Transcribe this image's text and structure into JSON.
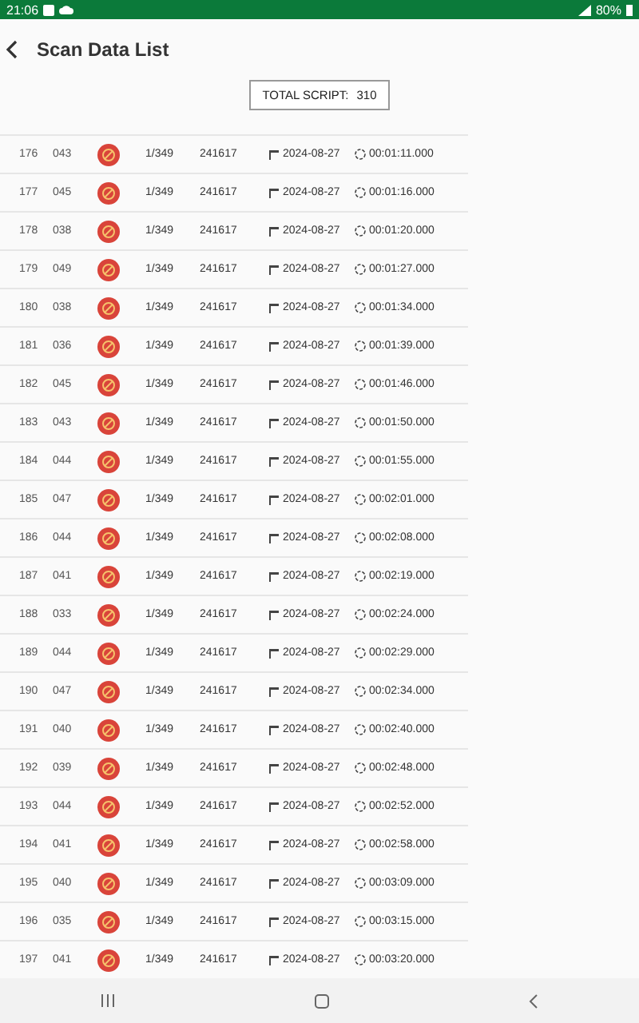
{
  "status_bar": {
    "time": "21:06",
    "battery": "80%"
  },
  "header": {
    "title": "Scan Data List"
  },
  "total": {
    "label": "TOTAL SCRIPT:",
    "value": "310"
  },
  "rows": [
    {
      "no": "176",
      "code": "043",
      "ref": "1/349",
      "batch": "241617",
      "date": "2024-08-27",
      "time": "00:01:11.000"
    },
    {
      "no": "177",
      "code": "045",
      "ref": "1/349",
      "batch": "241617",
      "date": "2024-08-27",
      "time": "00:01:16.000"
    },
    {
      "no": "178",
      "code": "038",
      "ref": "1/349",
      "batch": "241617",
      "date": "2024-08-27",
      "time": "00:01:20.000"
    },
    {
      "no": "179",
      "code": "049",
      "ref": "1/349",
      "batch": "241617",
      "date": "2024-08-27",
      "time": "00:01:27.000"
    },
    {
      "no": "180",
      "code": "038",
      "ref": "1/349",
      "batch": "241617",
      "date": "2024-08-27",
      "time": "00:01:34.000"
    },
    {
      "no": "181",
      "code": "036",
      "ref": "1/349",
      "batch": "241617",
      "date": "2024-08-27",
      "time": "00:01:39.000"
    },
    {
      "no": "182",
      "code": "045",
      "ref": "1/349",
      "batch": "241617",
      "date": "2024-08-27",
      "time": "00:01:46.000"
    },
    {
      "no": "183",
      "code": "043",
      "ref": "1/349",
      "batch": "241617",
      "date": "2024-08-27",
      "time": "00:01:50.000"
    },
    {
      "no": "184",
      "code": "044",
      "ref": "1/349",
      "batch": "241617",
      "date": "2024-08-27",
      "time": "00:01:55.000"
    },
    {
      "no": "185",
      "code": "047",
      "ref": "1/349",
      "batch": "241617",
      "date": "2024-08-27",
      "time": "00:02:01.000"
    },
    {
      "no": "186",
      "code": "044",
      "ref": "1/349",
      "batch": "241617",
      "date": "2024-08-27",
      "time": "00:02:08.000"
    },
    {
      "no": "187",
      "code": "041",
      "ref": "1/349",
      "batch": "241617",
      "date": "2024-08-27",
      "time": "00:02:19.000"
    },
    {
      "no": "188",
      "code": "033",
      "ref": "1/349",
      "batch": "241617",
      "date": "2024-08-27",
      "time": "00:02:24.000"
    },
    {
      "no": "189",
      "code": "044",
      "ref": "1/349",
      "batch": "241617",
      "date": "2024-08-27",
      "time": "00:02:29.000"
    },
    {
      "no": "190",
      "code": "047",
      "ref": "1/349",
      "batch": "241617",
      "date": "2024-08-27",
      "time": "00:02:34.000"
    },
    {
      "no": "191",
      "code": "040",
      "ref": "1/349",
      "batch": "241617",
      "date": "2024-08-27",
      "time": "00:02:40.000"
    },
    {
      "no": "192",
      "code": "039",
      "ref": "1/349",
      "batch": "241617",
      "date": "2024-08-27",
      "time": "00:02:48.000"
    },
    {
      "no": "193",
      "code": "044",
      "ref": "1/349",
      "batch": "241617",
      "date": "2024-08-27",
      "time": "00:02:52.000"
    },
    {
      "no": "194",
      "code": "041",
      "ref": "1/349",
      "batch": "241617",
      "date": "2024-08-27",
      "time": "00:02:58.000"
    },
    {
      "no": "195",
      "code": "040",
      "ref": "1/349",
      "batch": "241617",
      "date": "2024-08-27",
      "time": "00:03:09.000"
    },
    {
      "no": "196",
      "code": "035",
      "ref": "1/349",
      "batch": "241617",
      "date": "2024-08-27",
      "time": "00:03:15.000"
    },
    {
      "no": "197",
      "code": "041",
      "ref": "1/349",
      "batch": "241617",
      "date": "2024-08-27",
      "time": "00:03:20.000"
    }
  ]
}
